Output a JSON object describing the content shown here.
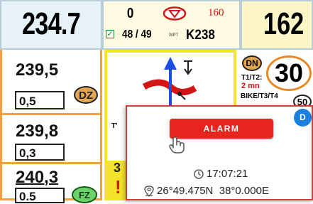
{
  "top_bar": {
    "left_speed": "234.7",
    "counter": "0",
    "speed_limit": "160",
    "waypoints": "48 / 49",
    "wpt_tag": "WPT",
    "waypoint_code": "K238",
    "right_speed": "162"
  },
  "left_panel": {
    "rows": [
      {
        "distance": "239,5",
        "sub": "0,5"
      },
      {
        "distance": "239,8",
        "sub": "0,3"
      },
      {
        "distance": "240,3",
        "sub": "0.5"
      }
    ],
    "dz_badge": "DZ",
    "fz_badge": "FZ"
  },
  "center_panel": {
    "bottom_number": "3",
    "bottom_mark": "!",
    "note_text": "T'"
  },
  "right_panel": {
    "dn_badge": "DN",
    "big_value": "30",
    "t1t2_label": "T1/T2:",
    "time_window": "2 mn",
    "bike_label": "BIKE/T3/T4",
    "small_value": "50"
  },
  "alarm": {
    "button_label": "ALARM",
    "time": "17:07:21",
    "coordinates": "26°49.475N  38°0.000E",
    "corner_badge": "D"
  },
  "colors": {
    "orange_border": "#f0a040",
    "yellow_border": "#f4e52b",
    "alarm_red": "#e8241e",
    "route_red": "#d21515",
    "route_blue": "#1b4fe0"
  }
}
